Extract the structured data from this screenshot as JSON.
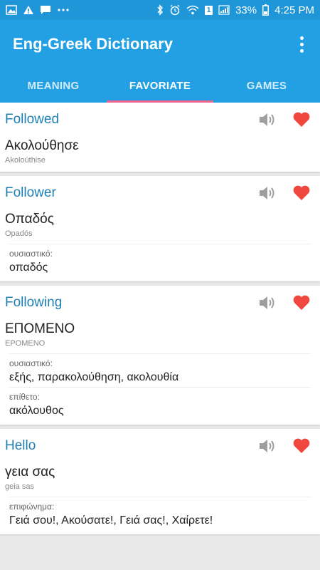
{
  "status_bar": {
    "time": "4:25 PM",
    "battery": "33%",
    "left_icons": [
      "image-icon",
      "warning-icon",
      "message-icon",
      "more-notifications-icon"
    ],
    "right_icons": [
      "bluetooth-icon",
      "alarm-icon",
      "wifi-icon",
      "sim-icon",
      "signal-icon",
      "battery-icon"
    ],
    "sim_label": "1"
  },
  "app_bar": {
    "title": "Eng-Greek Dictionary"
  },
  "tabs": [
    {
      "label": "MEANING",
      "active": false
    },
    {
      "label": "FAVORIATE",
      "active": true
    },
    {
      "label": "GAMES",
      "active": false
    }
  ],
  "colors": {
    "primary": "#22a0e3",
    "status": "#1e96d8",
    "indicator": "#f06292",
    "heart": "#f0473f",
    "word": "#1f7fb3"
  },
  "entries": [
    {
      "word": "Followed",
      "translation": "Ακολούθησε",
      "translit": "Akoloúthise",
      "senses": []
    },
    {
      "word": "Follower",
      "translation": "Οπαδός",
      "translit": "Opadós",
      "senses": [
        {
          "pos": "ουσιαστικό:",
          "text": "οπαδός"
        }
      ]
    },
    {
      "word": "Following",
      "translation": "ΕΠΟΜΕΝΟ",
      "translit": "EPOMENO",
      "senses": [
        {
          "pos": "ουσιαστικό:",
          "text": "εξής, παρακολούθηση, ακολουθία"
        },
        {
          "pos": "επίθετο:",
          "text": "ακόλουθος"
        }
      ]
    },
    {
      "word": "Hello",
      "translation": "γεια σας",
      "translit": "geia sas",
      "senses": [
        {
          "pos": "επιφώνημα:",
          "text": "Γειά σου!, Ακούσατε!, Γειά σας!, Χαίρετε!"
        }
      ]
    }
  ]
}
